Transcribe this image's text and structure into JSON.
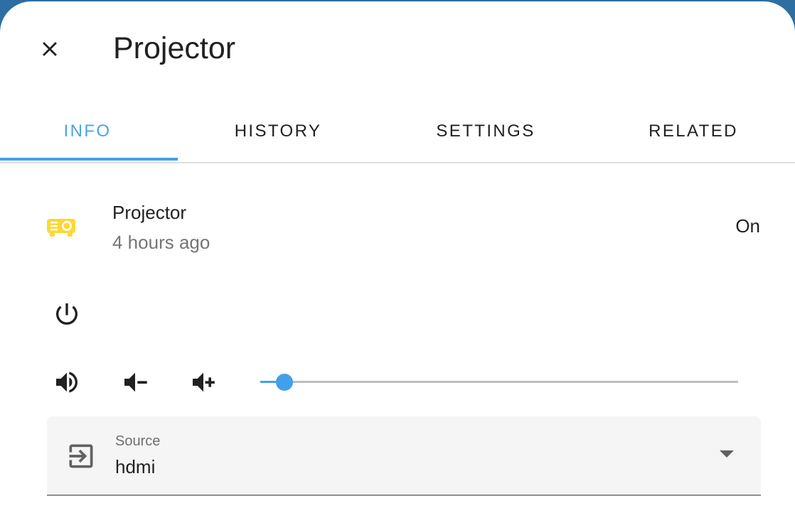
{
  "dialog": {
    "title": "Projector",
    "close_icon": "close-icon"
  },
  "tabs": [
    {
      "label": "INFO",
      "active": true
    },
    {
      "label": "HISTORY",
      "active": false
    },
    {
      "label": "SETTINGS",
      "active": false
    },
    {
      "label": "RELATED",
      "active": false
    }
  ],
  "entity": {
    "name": "Projector",
    "last_changed": "4 hours ago",
    "state": "On",
    "icon": "projector-icon",
    "icon_color": "#fdd835"
  },
  "controls": {
    "power_icon": "power-icon",
    "volume_mute_icon": "volume-high-icon",
    "volume_down_icon": "volume-minus-icon",
    "volume_up_icon": "volume-plus-icon",
    "volume_level": 0.05
  },
  "source": {
    "label": "Source",
    "value": "hdmi",
    "icon": "input-icon"
  },
  "colors": {
    "accent": "#41a0ea",
    "text": "#212121",
    "secondary_text": "#757575"
  }
}
